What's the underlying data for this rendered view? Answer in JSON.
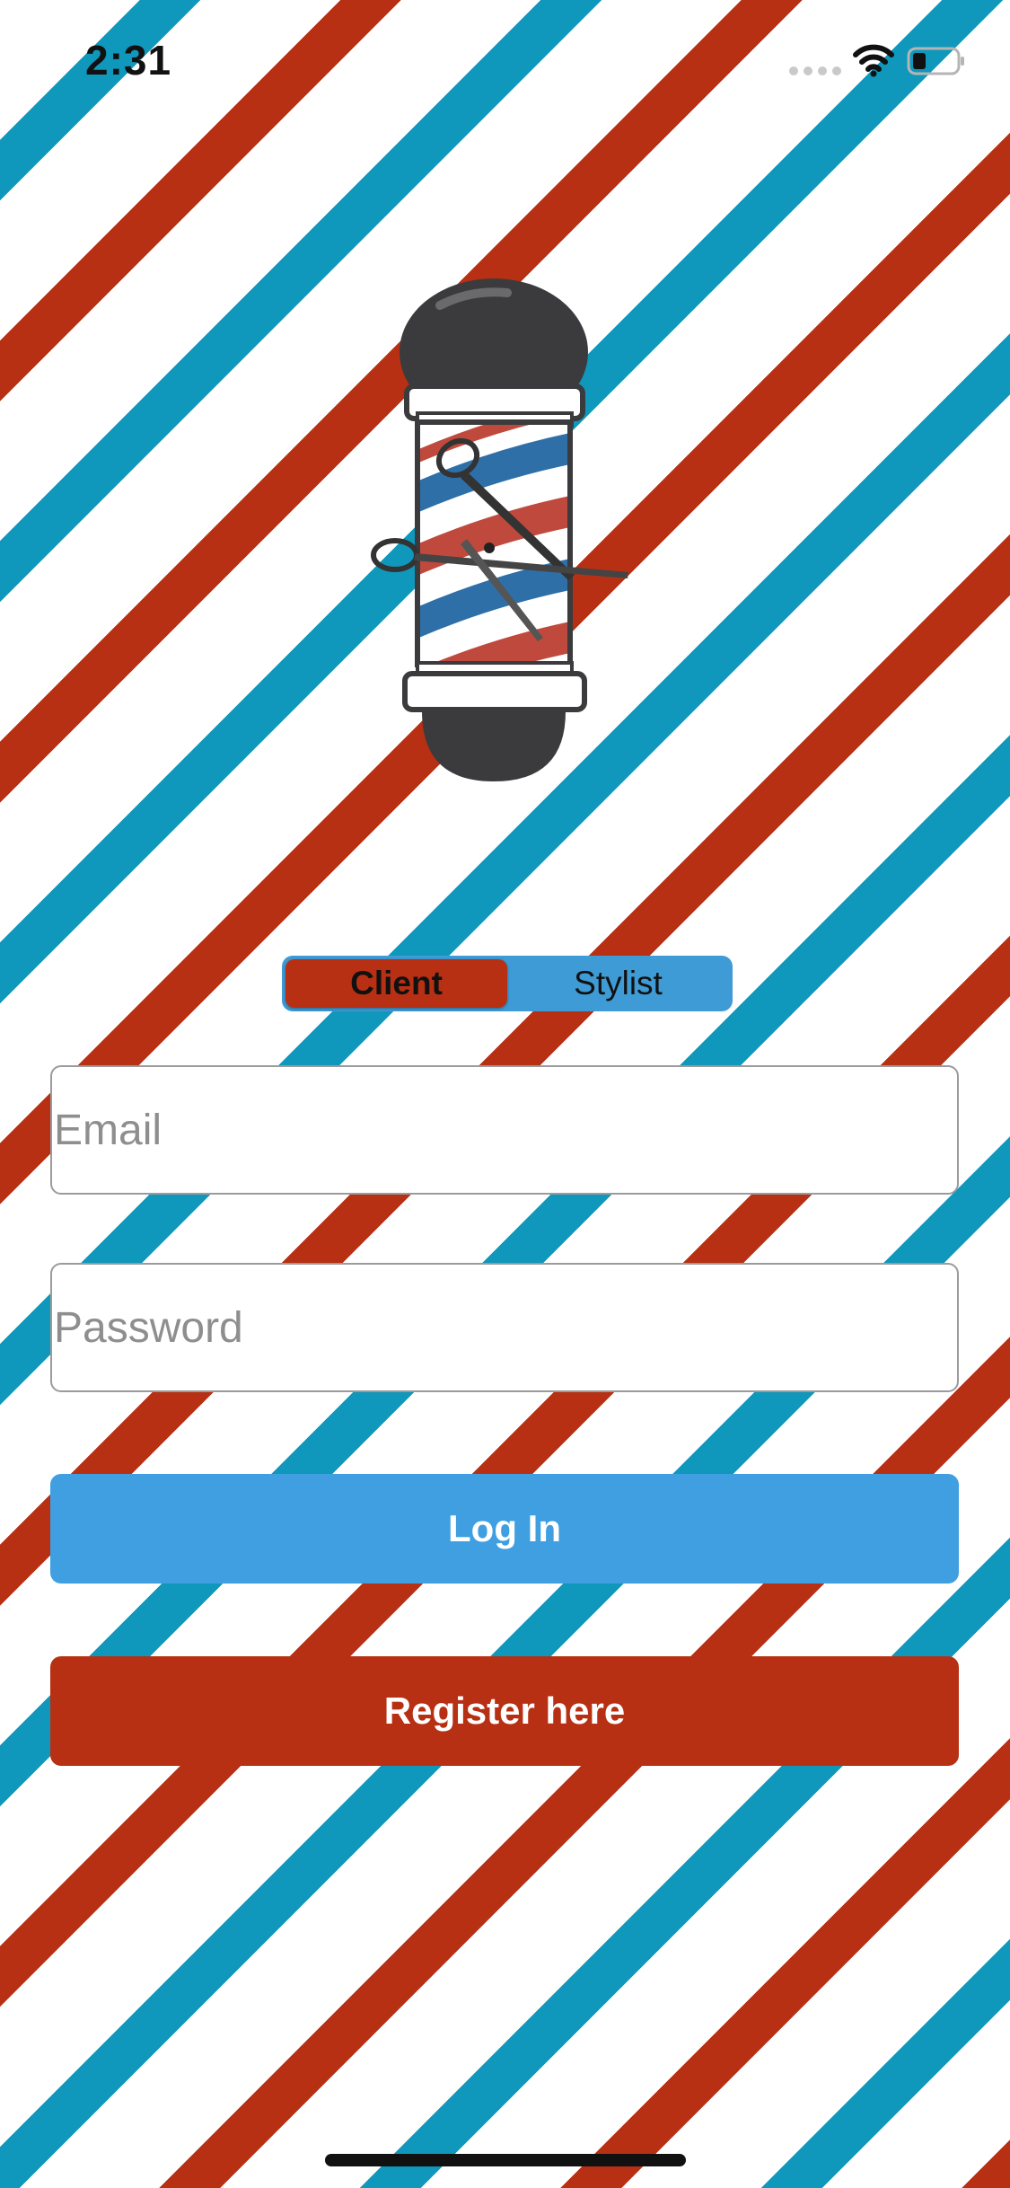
{
  "status_bar": {
    "time": "2:31",
    "icons": [
      "signal-dots-icon",
      "wifi-icon",
      "battery-icon"
    ]
  },
  "logo": {
    "icon": "barber-pole-with-scissors-icon"
  },
  "role_selector": {
    "options": [
      "Client",
      "Stylist"
    ],
    "selected": "Client"
  },
  "form": {
    "email_placeholder": "Email",
    "email_value": "",
    "password_placeholder": "Password",
    "password_value": ""
  },
  "buttons": {
    "login_label": "Log In",
    "register_label": "Register here"
  },
  "colors": {
    "stripe_red": "#b83013",
    "stripe_blue": "#0f98bb",
    "login_button": "#3f9fe0",
    "register_button": "#b83013",
    "segment_background": "#3f9bd6",
    "segment_active": "#b83013"
  }
}
